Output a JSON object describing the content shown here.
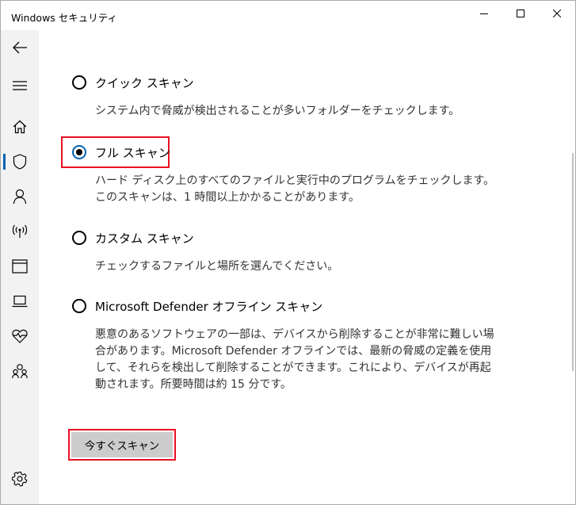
{
  "window": {
    "title": "Windows セキュリティ"
  },
  "sidebar": {
    "items": [
      {
        "icon": "back-arrow-icon"
      },
      {
        "icon": "hamburger-menu-icon"
      },
      {
        "icon": "home-icon"
      },
      {
        "icon": "shield-icon",
        "selected": true
      },
      {
        "icon": "person-icon"
      },
      {
        "icon": "antenna-icon"
      },
      {
        "icon": "browser-window-icon"
      },
      {
        "icon": "laptop-icon"
      },
      {
        "icon": "heart-pulse-icon"
      },
      {
        "icon": "family-icon"
      },
      {
        "icon": "settings-gear-icon"
      }
    ]
  },
  "scan_options": [
    {
      "label": "クイック スキャン",
      "selected": false,
      "description": "システム内で脅威が検出されることが多いフォルダーをチェックします。"
    },
    {
      "label": "フル スキャン",
      "selected": true,
      "description": "ハード ディスク上のすべてのファイルと実行中のプログラムをチェックします。このスキャンは、1 時間以上かかることがあります。"
    },
    {
      "label": "カスタム スキャン",
      "selected": false,
      "description": "チェックするファイルと場所を選んでください。"
    },
    {
      "label": "Microsoft Defender オフライン スキャン",
      "selected": false,
      "description": "悪意のあるソフトウェアの一部は、デバイスから削除することが非常に難しい場合があります。Microsoft Defender オフラインでは、最新の脅威の定義を使用して、それらを検出して削除することができます。これにより、デバイスが再起動されます。所要時間は約 15 分です。"
    }
  ],
  "scan_button": {
    "label": "今すぐスキャン"
  },
  "colors": {
    "accent": "#0063b1",
    "highlight": "#e81123",
    "sidebar_bg": "#f2f2f2",
    "button_bg": "#cccccc"
  }
}
